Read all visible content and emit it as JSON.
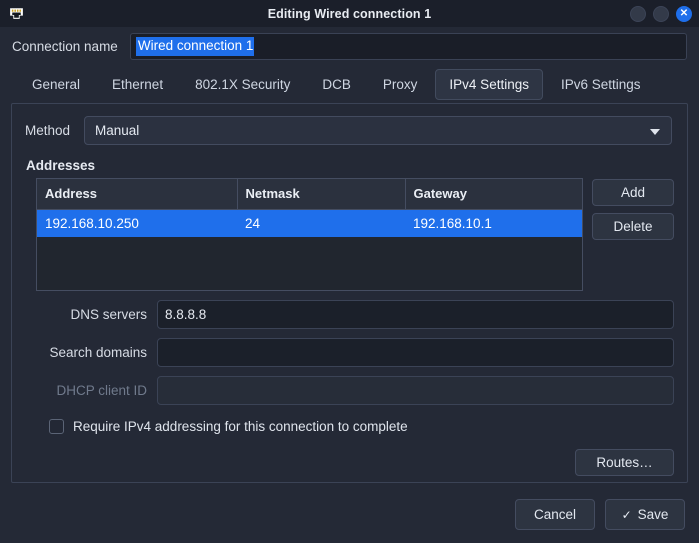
{
  "window": {
    "title": "Editing Wired connection 1",
    "icon": "ethernet-port-icon",
    "controls": {
      "minimize": "",
      "maximize": "",
      "close": "✕"
    },
    "accent_color": "#1f6feb",
    "background_color": "#242936"
  },
  "connection": {
    "name_label": "Connection name",
    "name_value": "Wired connection 1",
    "name_placeholder": ""
  },
  "tabs": [
    {
      "label": "General",
      "active": false
    },
    {
      "label": "Ethernet",
      "active": false
    },
    {
      "label": "802.1X Security",
      "active": false
    },
    {
      "label": "DCB",
      "active": false
    },
    {
      "label": "Proxy",
      "active": false
    },
    {
      "label": "IPv4 Settings",
      "active": true
    },
    {
      "label": "IPv6 Settings",
      "active": false
    }
  ],
  "ipv4": {
    "method_label": "Method",
    "method_value": "Manual",
    "addresses_title": "Addresses",
    "table": {
      "columns": [
        "Address",
        "Netmask",
        "Gateway"
      ],
      "rows": [
        {
          "cells": [
            "192.168.10.250",
            "24",
            "192.168.10.1"
          ],
          "selected": true
        }
      ]
    },
    "add_label": "Add",
    "delete_label": "Delete",
    "dns_label": "DNS servers",
    "dns_value": "8.8.8.8",
    "search_label": "Search domains",
    "search_value": "",
    "dhcp_label": "DHCP client ID",
    "dhcp_value": "",
    "dhcp_disabled": true,
    "require_label": "Require IPv4 addressing for this connection to complete",
    "require_checked": false,
    "routes_label": "Routes…"
  },
  "footer": {
    "cancel_label": "Cancel",
    "save_label": "Save",
    "save_icon": "✓"
  }
}
